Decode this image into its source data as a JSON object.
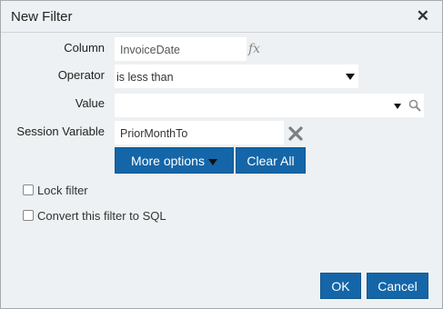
{
  "dialog": {
    "title": "New Filter",
    "close_icon": "close-icon"
  },
  "form": {
    "column": {
      "label": "Column",
      "value": "InvoiceDate",
      "fx_icon": "fx"
    },
    "operator": {
      "label": "Operator",
      "value": "is less than"
    },
    "value": {
      "label": "Value",
      "value": ""
    },
    "session_variable": {
      "label": "Session Variable",
      "value": "PriorMonthTo"
    }
  },
  "buttons": {
    "more_options": "More options",
    "clear_all": "Clear All",
    "ok": "OK",
    "cancel": "Cancel"
  },
  "checkboxes": {
    "lock_filter": {
      "label": "Lock filter",
      "checked": false
    },
    "convert_sql": {
      "label": "Convert this filter to SQL",
      "checked": false
    }
  },
  "colors": {
    "accent": "#1466a8",
    "background": "#eef1f3"
  }
}
